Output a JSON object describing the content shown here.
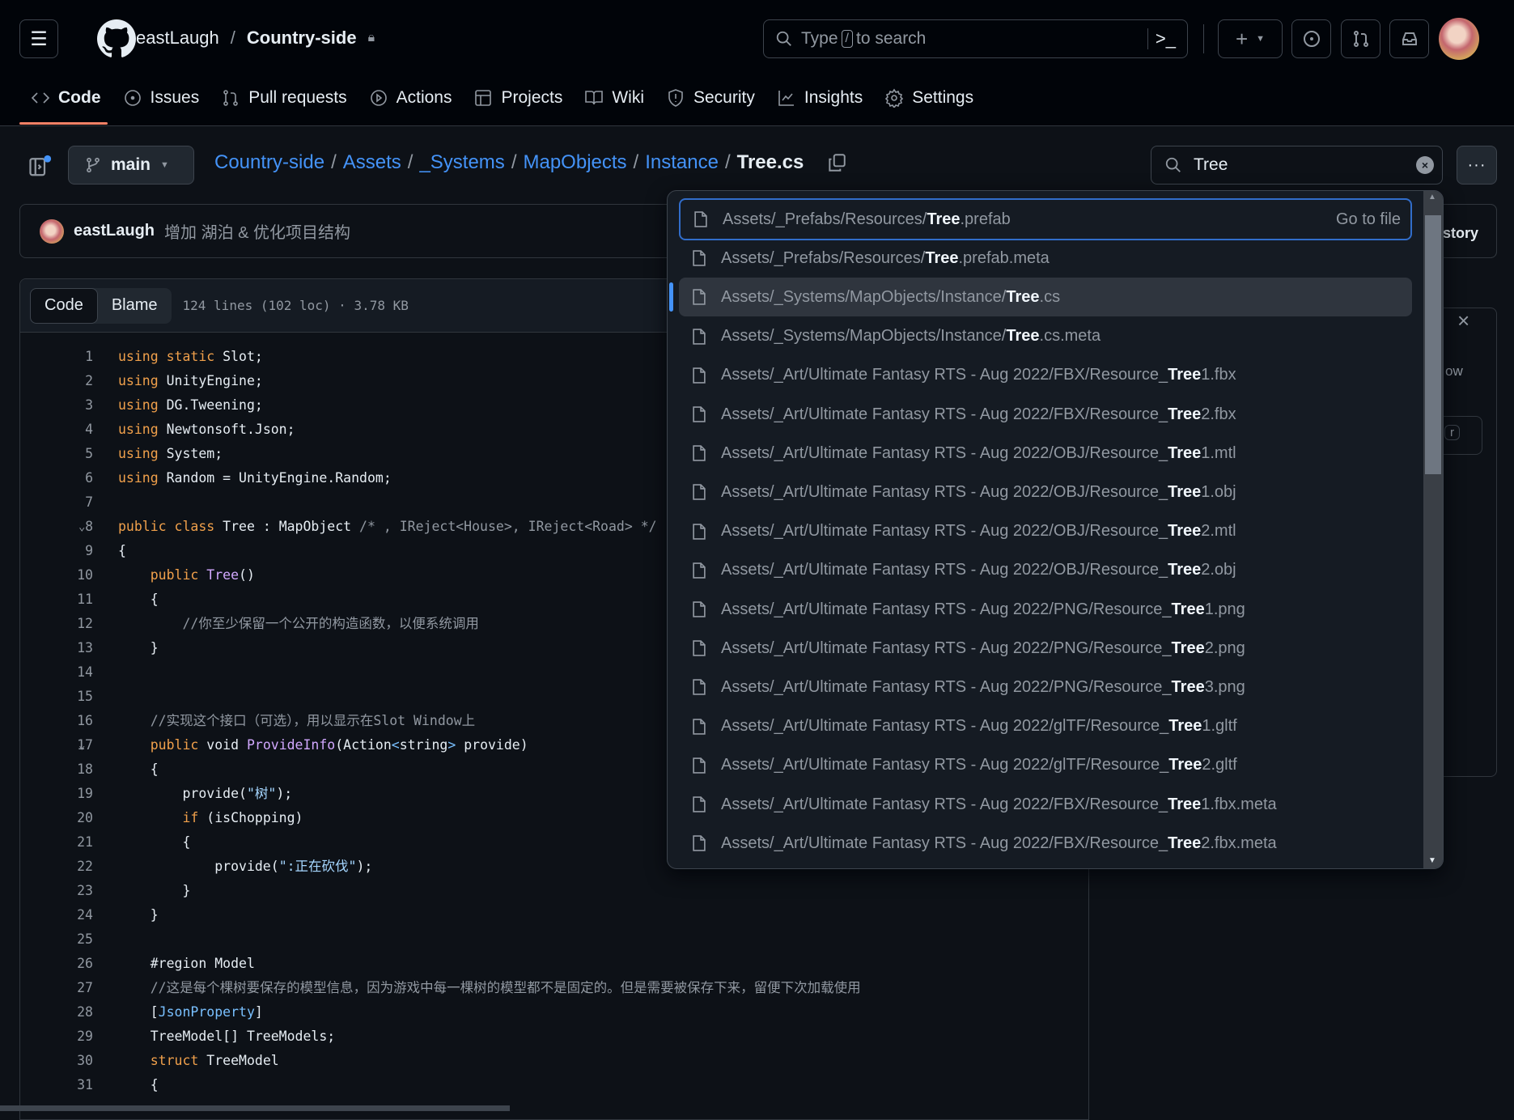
{
  "header": {
    "owner": "eastLaugh",
    "repo": "Country-side",
    "search_placeholder_pre": "Type",
    "search_key": "/",
    "search_placeholder_post": "to search"
  },
  "nav": [
    {
      "label": "Code",
      "icon": "code-icon",
      "active": true
    },
    {
      "label": "Issues",
      "icon": "issue-icon"
    },
    {
      "label": "Pull requests",
      "icon": "pull-request-icon"
    },
    {
      "label": "Actions",
      "icon": "play-icon"
    },
    {
      "label": "Projects",
      "icon": "table-icon"
    },
    {
      "label": "Wiki",
      "icon": "book-icon"
    },
    {
      "label": "Security",
      "icon": "shield-icon"
    },
    {
      "label": "Insights",
      "icon": "graph-icon"
    },
    {
      "label": "Settings",
      "icon": "gear-icon"
    }
  ],
  "branch": "main",
  "breadcrumb": [
    "Country-side",
    "Assets",
    "_Systems",
    "MapObjects",
    "Instance"
  ],
  "current_file": "Tree.cs",
  "file_search": {
    "value": "Tree"
  },
  "commit": {
    "author": "eastLaugh",
    "message": "增加 湖泊 & 优化项目结构",
    "history_partial": "story"
  },
  "side_panel": {
    "partial_text": "ow",
    "key": "r"
  },
  "code_view": {
    "tabs": [
      "Code",
      "Blame"
    ],
    "active_tab": "Code",
    "meta": "124 lines (102 loc) · 3.78 KB",
    "lines": [
      [
        [
          "using ",
          "k"
        ],
        [
          "static ",
          "k"
        ],
        [
          "Slot;",
          "p"
        ]
      ],
      [
        [
          "using ",
          "k"
        ],
        [
          "UnityEngine;",
          "p"
        ]
      ],
      [
        [
          "using ",
          "k"
        ],
        [
          "DG.Tweening;",
          "p"
        ]
      ],
      [
        [
          "using ",
          "k"
        ],
        [
          "Newtonsoft.Json;",
          "p"
        ]
      ],
      [
        [
          "using ",
          "k"
        ],
        [
          "System;",
          "p"
        ]
      ],
      [
        [
          "using ",
          "k"
        ],
        [
          "Random = UnityEngine.Random;",
          "p"
        ]
      ],
      [],
      [
        [
          "public ",
          "k"
        ],
        [
          "class ",
          "k"
        ],
        [
          "Tree : MapObject ",
          "p"
        ],
        [
          "/* , IReject<House>, IReject<Road> */ ,",
          "c"
        ]
      ],
      [
        [
          "{",
          "p"
        ]
      ],
      [
        [
          "    public ",
          "k"
        ],
        [
          "Tree",
          "f"
        ],
        [
          "()",
          "p"
        ]
      ],
      [
        [
          "    {",
          "p"
        ]
      ],
      [
        [
          "        //你至少保留一个公开的构造函数，以便系统调用",
          "c"
        ]
      ],
      [
        [
          "    }",
          "p"
        ]
      ],
      [],
      [],
      [
        [
          "    //实现这个接口（可选），用以显示在Slot Window上",
          "c"
        ]
      ],
      [
        [
          "    public ",
          "k"
        ],
        [
          "void ",
          "p"
        ],
        [
          "ProvideInfo",
          "f"
        ],
        [
          "(Action",
          "p"
        ],
        [
          "<",
          "t"
        ],
        [
          "string",
          "p"
        ],
        [
          ">",
          "t"
        ],
        [
          " provide)",
          "p"
        ]
      ],
      [
        [
          "    {",
          "p"
        ]
      ],
      [
        [
          "        provide(",
          "p"
        ],
        [
          "\"树\"",
          "s"
        ],
        [
          ");",
          "p"
        ]
      ],
      [
        [
          "        if ",
          "k"
        ],
        [
          "(isChopping)",
          "p"
        ]
      ],
      [
        [
          "        {",
          "p"
        ]
      ],
      [
        [
          "            provide(",
          "p"
        ],
        [
          "\":正在砍伐\"",
          "s"
        ],
        [
          ");",
          "p"
        ]
      ],
      [
        [
          "        }",
          "p"
        ]
      ],
      [
        [
          "    }",
          "p"
        ]
      ],
      [],
      [
        [
          "    #region Model",
          "p"
        ]
      ],
      [
        [
          "    //这是每个棵树要保存的模型信息，因为游戏中每一棵树的模型都不是固定的。但是需要被保存下来，留便下次加载使用",
          "c"
        ]
      ],
      [
        [
          "    [",
          "p"
        ],
        [
          "JsonProperty",
          "t"
        ],
        [
          "]",
          "p"
        ]
      ],
      [
        [
          "    TreeModel[] TreeModels;",
          "p"
        ]
      ],
      [
        [
          "    struct ",
          "k"
        ],
        [
          "TreeModel",
          "p"
        ]
      ],
      [
        [
          "    {",
          "p"
        ]
      ]
    ],
    "folded_lines": [
      8,
      17
    ]
  },
  "dropdown": {
    "go_to_file": "Go to file",
    "current_index": 2,
    "results": [
      {
        "pre": "Assets/_Prefabs/Resources/",
        "match": "Tree",
        "post": ".prefab"
      },
      {
        "pre": "Assets/_Prefabs/Resources/",
        "match": "Tree",
        "post": ".prefab.meta"
      },
      {
        "pre": "Assets/_Systems/MapObjects/Instance/",
        "match": "Tree",
        "post": ".cs"
      },
      {
        "pre": "Assets/_Systems/MapObjects/Instance/",
        "match": "Tree",
        "post": ".cs.meta"
      },
      {
        "pre": "Assets/_Art/Ultimate Fantasy RTS - Aug 2022/FBX/Resource_",
        "match": "Tree",
        "post": "1.fbx"
      },
      {
        "pre": "Assets/_Art/Ultimate Fantasy RTS - Aug 2022/FBX/Resource_",
        "match": "Tree",
        "post": "2.fbx"
      },
      {
        "pre": "Assets/_Art/Ultimate Fantasy RTS - Aug 2022/OBJ/Resource_",
        "match": "Tree",
        "post": "1.mtl"
      },
      {
        "pre": "Assets/_Art/Ultimate Fantasy RTS - Aug 2022/OBJ/Resource_",
        "match": "Tree",
        "post": "1.obj"
      },
      {
        "pre": "Assets/_Art/Ultimate Fantasy RTS - Aug 2022/OBJ/Resource_",
        "match": "Tree",
        "post": "2.mtl"
      },
      {
        "pre": "Assets/_Art/Ultimate Fantasy RTS - Aug 2022/OBJ/Resource_",
        "match": "Tree",
        "post": "2.obj"
      },
      {
        "pre": "Assets/_Art/Ultimate Fantasy RTS - Aug 2022/PNG/Resource_",
        "match": "Tree",
        "post": "1.png"
      },
      {
        "pre": "Assets/_Art/Ultimate Fantasy RTS - Aug 2022/PNG/Resource_",
        "match": "Tree",
        "post": "2.png"
      },
      {
        "pre": "Assets/_Art/Ultimate Fantasy RTS - Aug 2022/PNG/Resource_",
        "match": "Tree",
        "post": "3.png"
      },
      {
        "pre": "Assets/_Art/Ultimate Fantasy RTS - Aug 2022/glTF/Resource_",
        "match": "Tree",
        "post": "1.gltf"
      },
      {
        "pre": "Assets/_Art/Ultimate Fantasy RTS - Aug 2022/glTF/Resource_",
        "match": "Tree",
        "post": "2.gltf"
      },
      {
        "pre": "Assets/_Art/Ultimate Fantasy RTS - Aug 2022/FBX/Resource_",
        "match": "Tree",
        "post": "1.fbx.meta"
      },
      {
        "pre": "Assets/_Art/Ultimate Fantasy RTS - Aug 2022/FBX/Resource_",
        "match": "Tree",
        "post": "2.fbx.meta"
      }
    ]
  },
  "colors": {
    "accent": "#4493f8",
    "underline": "#f78166",
    "background": "#0d1117"
  }
}
